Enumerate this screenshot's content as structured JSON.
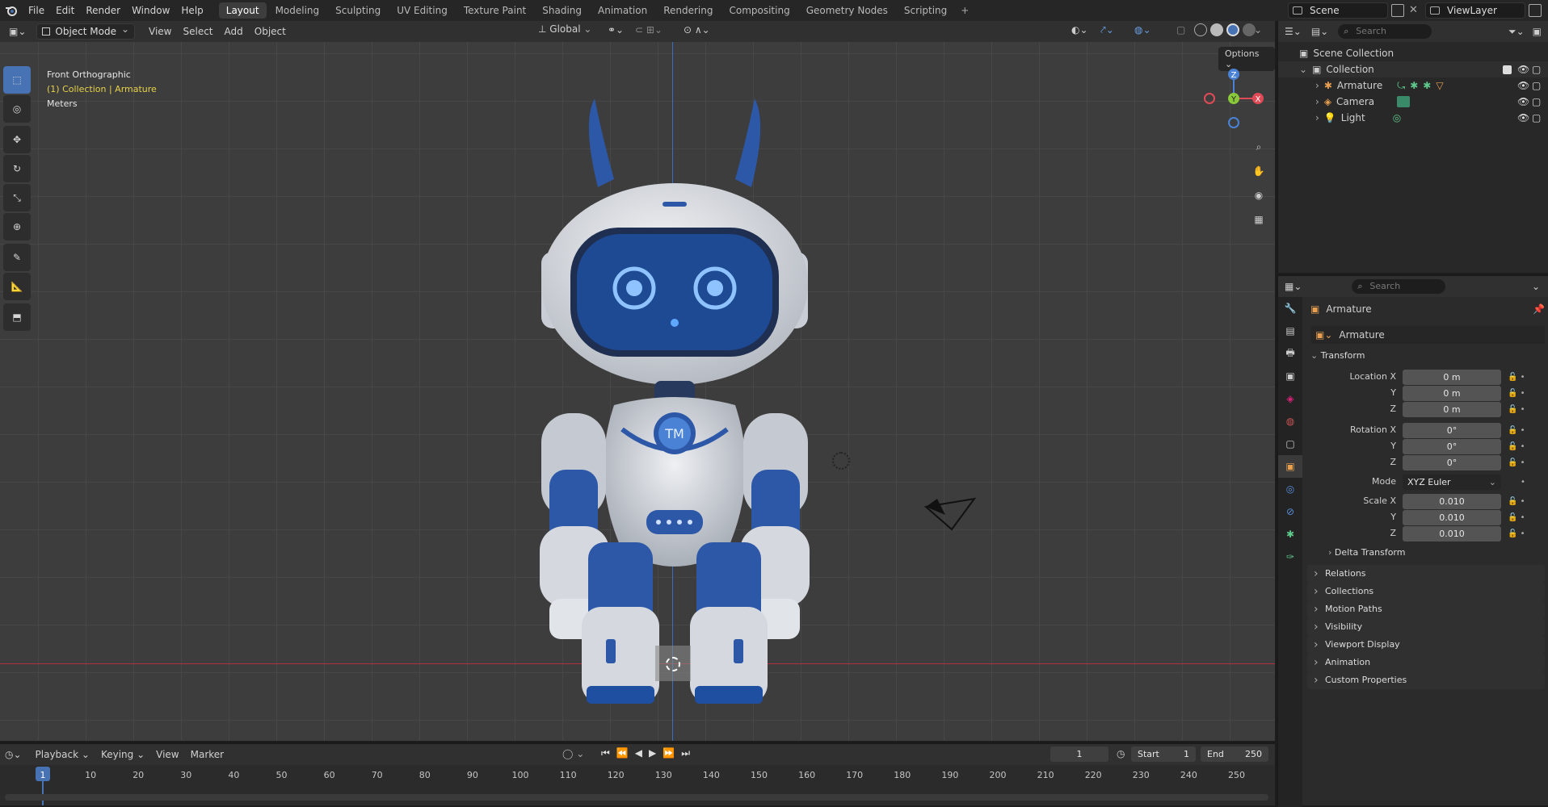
{
  "topbar": {
    "menus": [
      "File",
      "Edit",
      "Render",
      "Window",
      "Help"
    ],
    "workspaces": [
      "Layout",
      "Modeling",
      "Sculpting",
      "UV Editing",
      "Texture Paint",
      "Shading",
      "Animation",
      "Rendering",
      "Compositing",
      "Geometry Nodes",
      "Scripting"
    ],
    "active_workspace": "Layout",
    "scene": "Scene",
    "view_layer": "ViewLayer"
  },
  "viewport_header": {
    "mode": "Object Mode",
    "menus": [
      "View",
      "Select",
      "Add",
      "Object"
    ],
    "orientation": "Global",
    "options": "Options"
  },
  "viewport": {
    "view_name": "Front Orthographic",
    "collection_info": "(1) Collection | Armature",
    "units": "Meters",
    "robot_badge": "TM",
    "gizmo": {
      "z": "Z",
      "y": "Y",
      "x": "X"
    }
  },
  "outliner": {
    "search_placeholder": "Search",
    "scene_collection": "Scene Collection",
    "collection": "Collection",
    "items": [
      {
        "name": "Armature",
        "icon": "armature-icon"
      },
      {
        "name": "Camera",
        "icon": "camera-icon"
      },
      {
        "name": "Light",
        "icon": "light-icon"
      }
    ]
  },
  "properties": {
    "search_placeholder": "Search",
    "object_name": "Armature",
    "object_field": "Armature",
    "transform_label": "Transform",
    "location": {
      "label_x": "Location X",
      "label_y": "Y",
      "label_z": "Z",
      "x": "0 m",
      "y": "0 m",
      "z": "0 m"
    },
    "rotation": {
      "label_x": "Rotation X",
      "label_y": "Y",
      "label_z": "Z",
      "x": "0°",
      "y": "0°",
      "z": "0°"
    },
    "mode_label": "Mode",
    "mode_value": "XYZ Euler",
    "scale": {
      "label_x": "Scale X",
      "label_y": "Y",
      "label_z": "Z",
      "x": "0.010",
      "y": "0.010",
      "z": "0.010"
    },
    "delta_transform": "Delta Transform",
    "sections": [
      "Relations",
      "Collections",
      "Motion Paths",
      "Visibility",
      "Viewport Display",
      "Animation",
      "Custom Properties"
    ]
  },
  "timeline": {
    "menus": [
      "Playback",
      "Keying",
      "View",
      "Marker"
    ],
    "current_frame": "1",
    "start_label": "Start",
    "start": "1",
    "end_label": "End",
    "end": "250",
    "ticks": [
      "1",
      "10",
      "20",
      "30",
      "40",
      "50",
      "60",
      "70",
      "80",
      "90",
      "100",
      "110",
      "120",
      "130",
      "140",
      "150",
      "160",
      "170",
      "180",
      "190",
      "200",
      "210",
      "220",
      "230",
      "240",
      "250"
    ]
  },
  "colors": {
    "accent": "#4772b3",
    "robot_blue": "#1f4fa0",
    "x_axis": "#e04a56",
    "y_axis": "#8ac83b",
    "z_axis": "#4a82d6"
  }
}
